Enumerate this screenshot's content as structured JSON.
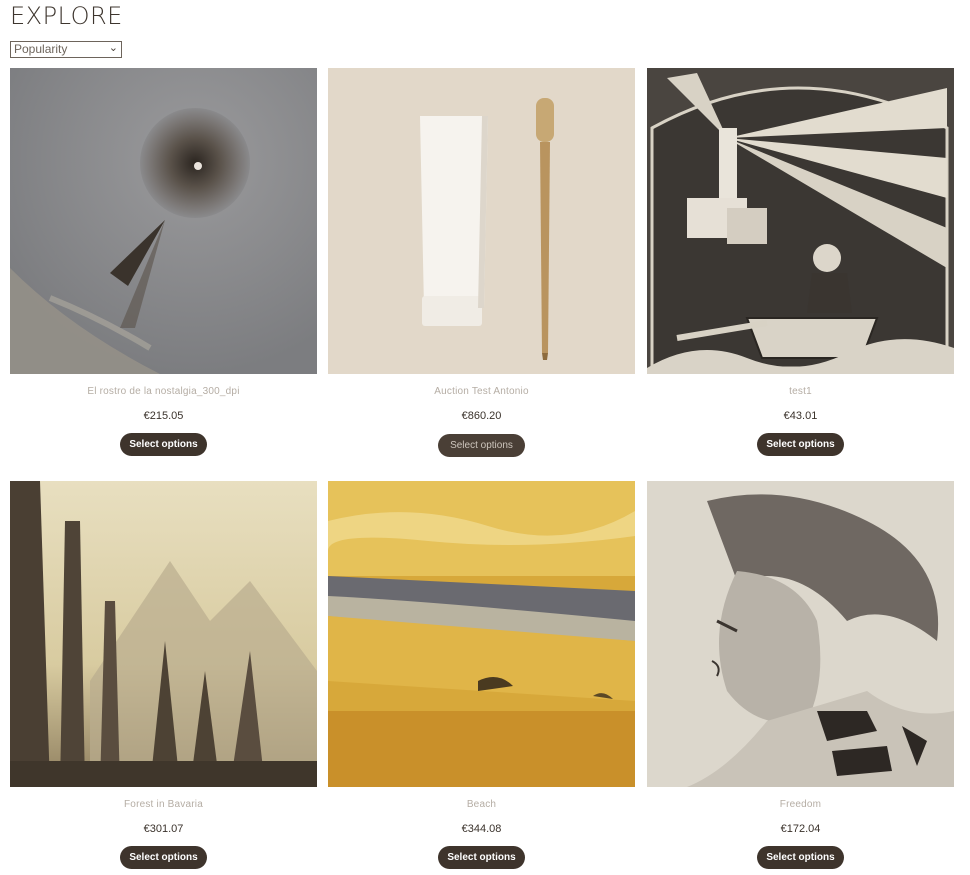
{
  "page": {
    "title": "EXPLORE"
  },
  "sort": {
    "selected": "Popularity"
  },
  "products": [
    {
      "name": "El rostro de la nostalgia_300_dpi",
      "price": "€215.05",
      "button": "Select options",
      "image": "surreal-eye-artwork"
    },
    {
      "name": "Auction Test Antonio",
      "price": "€860.20",
      "button": "Select options",
      "image": "toothpaste-and-bamboo-toothbrush"
    },
    {
      "name": "test1",
      "price": "€43.01",
      "button": "Select options",
      "image": "lighthouse-rowboat-illustration"
    },
    {
      "name": "Forest in Bavaria",
      "price": "€301.07",
      "button": "Select options",
      "image": "misty-forest-mountains-painting"
    },
    {
      "name": "Beach",
      "price": "€344.08",
      "button": "Select options",
      "image": "yellow-beach-painting"
    },
    {
      "name": "Freedom",
      "price": "€172.04",
      "button": "Select options",
      "image": "woman-portrait-drawing"
    }
  ]
}
